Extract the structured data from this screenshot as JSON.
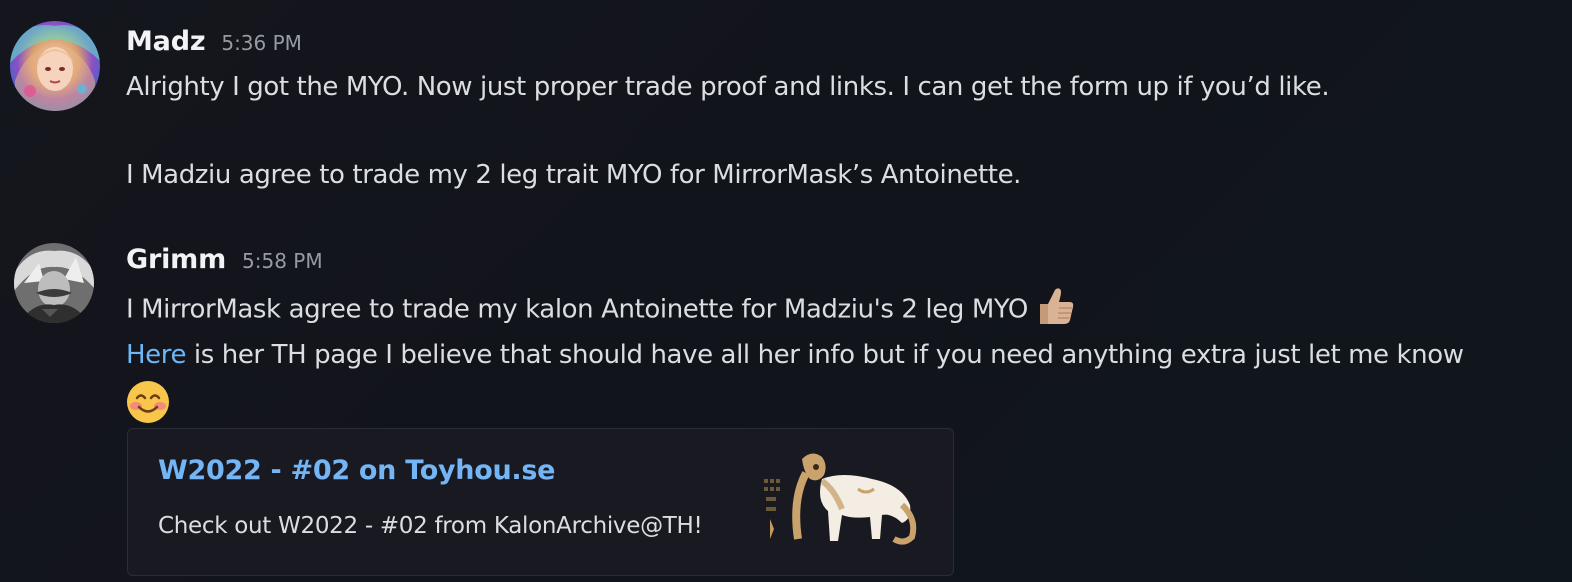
{
  "messages": [
    {
      "author": "Madz",
      "timestamp": "5:36 PM",
      "lines": [
        "Alrighty I got the MYO. Now just proper trade proof and links. I can get the form up if you’d like.",
        "I Madziu agree to trade my 2 leg trait MYO for MirrorMask’s Antoinette."
      ]
    },
    {
      "author": "Grimm",
      "timestamp": "5:58 PM",
      "line1": "I MirrorMask agree to trade my kalon Antoinette for Madziu's 2 leg MYO",
      "line1_emoji": "thumbs-up-icon",
      "line2_link": "Here",
      "line2_text": " is her TH page I believe that should have all her info but if you need anything extra just let me know",
      "line2_emoji": "smiling-face-icon",
      "embed": {
        "title": "W2022 - #02 on Toyhou.se",
        "description": "Check out W2022 - #02 from KalonArchive@TH!"
      }
    }
  ],
  "colors": {
    "background": "#13151b",
    "link": "#6eb6f5",
    "author": "#f2f3f5",
    "timestamp": "#949ba4",
    "text": "#dbdee1",
    "embed_bg": "#191a21"
  }
}
